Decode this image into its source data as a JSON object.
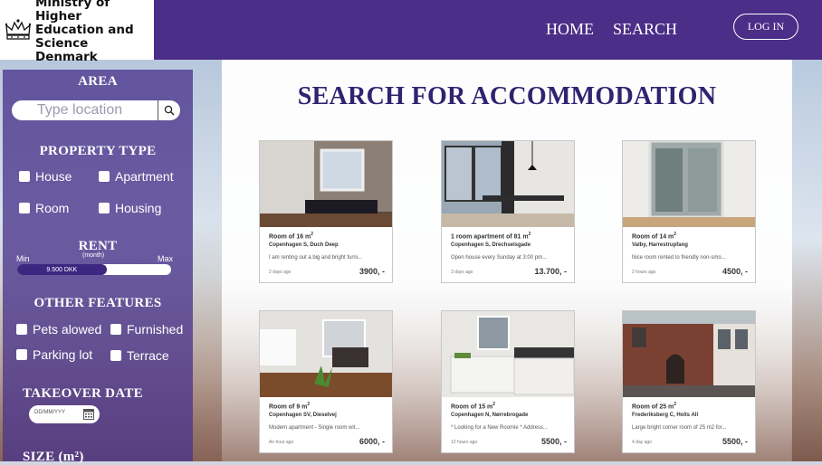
{
  "brand": {
    "name": "Ministry of Higher\nEducation and\nScience Denmark"
  },
  "nav": {
    "home": "HOME",
    "search": "SEARCH",
    "login": "LOG IN"
  },
  "sidebar": {
    "area_heading": "AREA",
    "location_placeholder": "Type location",
    "property_heading": "PROPERTY TYPE",
    "property_types": [
      "House",
      "Apartment",
      "Room",
      "Housing"
    ],
    "rent_heading": "RENT",
    "rent_sub": "(month)",
    "rent_min_label": "Min",
    "rent_max_label": "Max",
    "rent_value": "9.500 DKK",
    "rent_fill_fraction": 0.58,
    "features_heading": "OTHER FEATURES",
    "features": [
      "Pets alowed",
      "Furnished",
      "Parking lot",
      "Terrace"
    ],
    "takeover_heading": "TAKEOVER DATE",
    "date_placeholder": "DD/MM/YYY",
    "size_heading": "SIZE (m²)"
  },
  "main": {
    "title": "SEARCH FOR ACCOMMODATION",
    "listings": [
      {
        "title": "Room of 16 m",
        "sup": "2",
        "address": "Copenhagen S, Duch Deep",
        "desc": "I am renting out a big and bright furni...",
        "time": "2 days ago",
        "price": "3900, -"
      },
      {
        "title": "1 room apartment of 81 m",
        "sup": "2",
        "address": "Copenhagen S, Drechselsgade",
        "desc": "Open house every Sunday at 3:00 pm...",
        "time": "3 days ago",
        "price": "13.700, -"
      },
      {
        "title": "Room of 14 m",
        "sup": "2",
        "address": "Valby, Harrestrupfang",
        "desc": "Nice room rented to friendly non-smo...",
        "time": "2 hours ago",
        "price": "4500, -"
      },
      {
        "title": "Room of 9 m",
        "sup": "2",
        "address": "Copenhagen SV, Dieselvej",
        "desc": "Modern apartment - Single room wit...",
        "time": "An hour ago",
        "price": "6000, -"
      },
      {
        "title": "Room of 15 m",
        "sup": "2",
        "address": "Copenhagen N, Nørrebrogade",
        "desc": "* Looking for a New Roomie * Address...",
        "time": "12 hours ago",
        "price": "5500, -"
      },
      {
        "title": "Room of 25 m",
        "sup": "2",
        "address": "Frederiksberg C, Holls All",
        "desc": "Large bright corner room of 25 m2 for...",
        "time": "4 day ago",
        "price": "5500, -"
      }
    ]
  },
  "colors": {
    "header": "#4b2e88",
    "title": "#2e2470",
    "sidebar": "#4a348c"
  },
  "icons": [
    "crown-icon",
    "search-icon",
    "calendar-icon"
  ]
}
